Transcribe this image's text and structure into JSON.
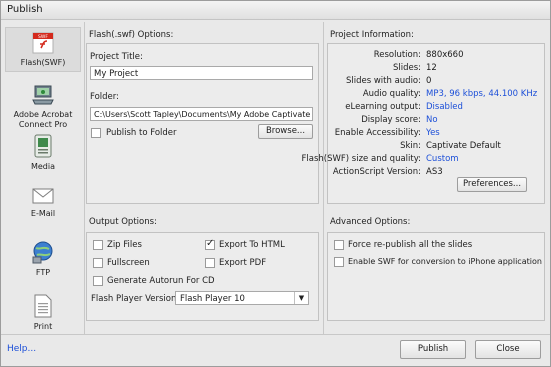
{
  "title": "Publish",
  "sidebar": {
    "items": [
      {
        "label": "Flash(SWF)",
        "icon": "flash-swf-icon",
        "selected": true
      },
      {
        "label": "Adobe Acrobat Connect Pro",
        "icon": "acrobat-connect-icon",
        "selected": false
      },
      {
        "label": "Media",
        "icon": "media-icon",
        "selected": false
      },
      {
        "label": "E-Mail",
        "icon": "email-icon",
        "selected": false
      },
      {
        "label": "FTP",
        "icon": "ftp-icon",
        "selected": false
      },
      {
        "label": "Print",
        "icon": "print-icon",
        "selected": false
      }
    ]
  },
  "flash_options": {
    "header": "Flash(.swf) Options:",
    "project_title_label": "Project Title:",
    "project_title_value": "My Project",
    "folder_label": "Folder:",
    "folder_value": "C:\\Users\\Scott Tapley\\Documents\\My Adobe Captivate Projects",
    "publish_to_folder_label": "Publish to Folder",
    "publish_to_folder_checked": false,
    "browse_label": "Browse..."
  },
  "project_info": {
    "header": "Project Information:",
    "rows": [
      {
        "label": "Resolution:",
        "value": "880x660",
        "highlight": false
      },
      {
        "label": "Slides:",
        "value": "12",
        "highlight": false
      },
      {
        "label": "Slides with audio:",
        "value": "0",
        "highlight": false
      },
      {
        "label": "Audio quality:",
        "value": "MP3, 96 kbps, 44.100 KHz",
        "highlight": true
      },
      {
        "label": "eLearning output:",
        "value": "Disabled",
        "highlight": true
      },
      {
        "label": "Display score:",
        "value": "No",
        "highlight": true
      },
      {
        "label": "Enable Accessibility:",
        "value": "Yes",
        "highlight": true
      },
      {
        "label": "Skin:",
        "value": "Captivate Default",
        "highlight": false
      },
      {
        "label": "Flash(SWF) size and quality:",
        "value": "Custom",
        "highlight": true
      },
      {
        "label": "ActionScript Version:",
        "value": "AS3",
        "highlight": false
      }
    ],
    "preferences_label": "Preferences..."
  },
  "output_options": {
    "header": "Output Options:",
    "zip_files": {
      "label": "Zip Files",
      "checked": false
    },
    "export_html": {
      "label": "Export To HTML",
      "checked": true
    },
    "fullscreen": {
      "label": "Fullscreen",
      "checked": false
    },
    "export_pdf": {
      "label": "Export PDF",
      "checked": false
    },
    "autorun": {
      "label": "Generate Autorun For CD",
      "checked": false
    },
    "player_version_label": "Flash Player Version:",
    "player_version_value": "Flash Player 10"
  },
  "advanced_options": {
    "header": "Advanced Options:",
    "force_republish": {
      "label": "Force re-publish all the slides",
      "checked": false
    },
    "enable_swf_iphone": {
      "label": "Enable SWF for conversion to iPhone application",
      "checked": false
    }
  },
  "footer": {
    "help_label": "Help...",
    "publish_label": "Publish",
    "close_label": "Close"
  },
  "colors": {
    "highlight_value": "#1c4fd8",
    "flash_icon_red": "#d42a1d"
  }
}
